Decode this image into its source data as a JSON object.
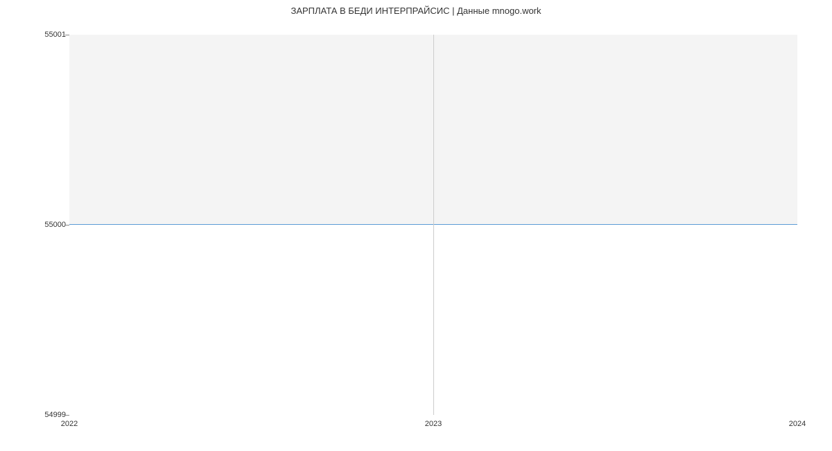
{
  "chart_data": {
    "type": "area",
    "title": "ЗАРПЛАТА В  БЕДИ ИНТЕРПРАЙСИС | Данные mnogo.work",
    "xlabel": "",
    "ylabel": "",
    "x": [
      2022,
      2023,
      2024
    ],
    "values": [
      55000,
      55000,
      55000
    ],
    "xlim": [
      2022,
      2024
    ],
    "ylim": [
      54999,
      55001
    ],
    "y_ticks": [
      54999,
      55000,
      55001
    ],
    "x_ticks": [
      2022,
      2023,
      2024
    ],
    "line_color": "#5b9bd5",
    "fill_color": "#f4f4f4"
  }
}
